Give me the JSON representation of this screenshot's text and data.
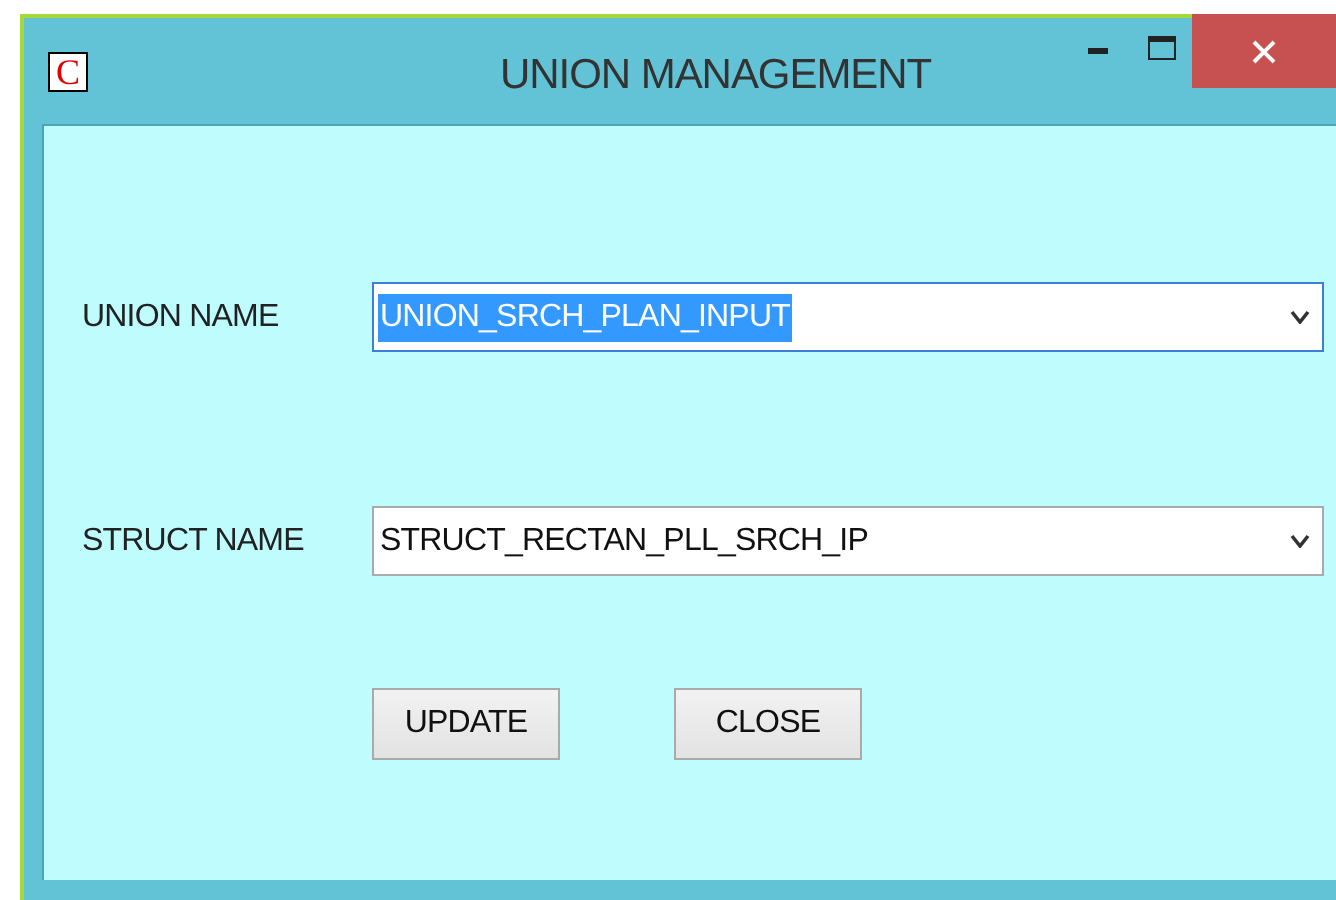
{
  "window": {
    "app_icon": "C",
    "title": "UNION MANAGEMENT"
  },
  "fields": [
    {
      "label": "UNION NAME",
      "value": "UNION_SRCH_PLAN_INPUT",
      "selected": true
    },
    {
      "label": "STRUCT NAME",
      "value": "STRUCT_RECTAN_PLL_SRCH_IP",
      "selected": false
    }
  ],
  "buttons": [
    "UPDATE",
    "CLOSE"
  ]
}
